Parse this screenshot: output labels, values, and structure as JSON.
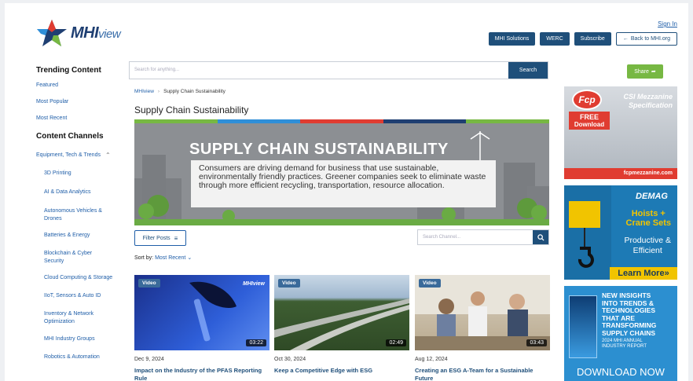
{
  "header": {
    "logo_text": "MHI",
    "logo_suffix": "view",
    "sign_in": "Sign In",
    "buttons": [
      "MHI Solutions",
      "WERC",
      "Subscribe"
    ],
    "back_link": "Back to MHI.org"
  },
  "sidebar": {
    "trending_heading": "Trending Content",
    "trending_links": [
      "Featured",
      "Most Popular",
      "Most Recent"
    ],
    "channels_heading": "Content Channels",
    "group_label": "Equipment, Tech & Trends",
    "channels": [
      "3D Printing",
      "AI & Data Analytics",
      "Autonomous Vehicles & Drones",
      "Batteries & Energy",
      "Blockchain & Cyber Security",
      "Cloud Computing & Storage",
      "IIoT, Sensors & Auto ID",
      "Inventory & Network Optimization",
      "MHI Industry Groups",
      "Robotics & Automation"
    ]
  },
  "search": {
    "placeholder": "Search for anything...",
    "button": "Search"
  },
  "breadcrumb": {
    "root": "MHIview",
    "current": "Supply Chain Sustainability"
  },
  "page_title": "Supply Chain Sustainability",
  "banner": {
    "title": "SUPPLY CHAIN SUSTAINABILITY",
    "text": "Consumers are driving demand for business that use sustainable, environmentally friendly practices. Greener companies seek to eliminate waste through more efficient recycling, transportation, resource allocation.",
    "stripe_colors": [
      "#77b843",
      "#2f8fd8",
      "#e03c31",
      "#1f3f72",
      "#77b843"
    ]
  },
  "filter": {
    "label": "Filter Posts",
    "channel_search_placeholder": "Search Channel..."
  },
  "sort": {
    "label": "Sort by:",
    "value": "Most Recent"
  },
  "cards": [
    {
      "badge": "Video",
      "watermark": "MHIview",
      "duration": "03:22",
      "date": "Dec 9, 2024",
      "title": "Impact on the Industry of the PFAS Reporting Rule"
    },
    {
      "badge": "Video",
      "duration": "02:49",
      "date": "Oct 30, 2024",
      "title": "Keep a Competitive Edge with ESG"
    },
    {
      "badge": "Video",
      "duration": "03:43",
      "date": "Aug 12, 2024",
      "title": "Creating an ESG A-Team for a Sustainable Future"
    }
  ],
  "share": {
    "label": "Share"
  },
  "ads": {
    "fcp": {
      "logo": "Fcp",
      "free": "FREE",
      "download": "Download",
      "heading_1": "CSI Mezzanine",
      "heading_2": "Specification",
      "url": "fcpmezzanine.com"
    },
    "demag": {
      "brand": "DEMAG",
      "line_1": "Hoists +",
      "line_2": "Crane Sets",
      "line_3": "Productive &",
      "line_4": "Efficient",
      "cta": "Learn More"
    },
    "report": {
      "line_1": "NEW INSIGHTS",
      "line_2": "INTO TRENDS &",
      "line_3": "TECHNOLOGIES",
      "line_4": "THAT ARE",
      "line_5": "TRANSFORMING",
      "line_6": "SUPPLY CHAINS",
      "sub_1": "2024 MHI ANNUAL",
      "sub_2": "INDUSTRY REPORT",
      "cta": "DOWNLOAD NOW"
    }
  }
}
